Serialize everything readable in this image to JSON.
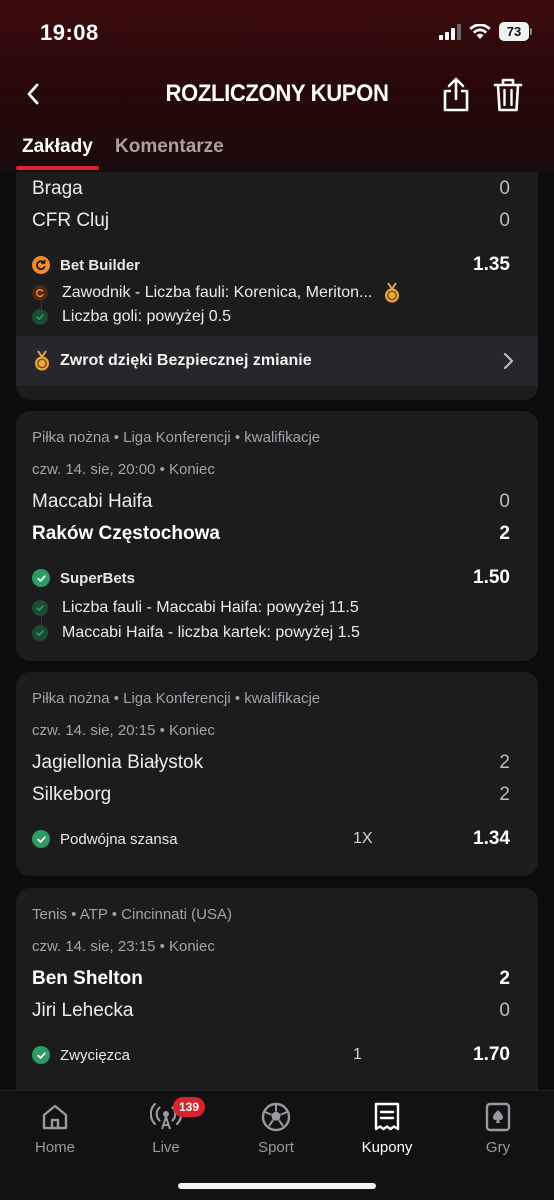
{
  "status": {
    "time": "19:08",
    "battery": "73"
  },
  "header": {
    "title": "ROZLICZONY KUPON"
  },
  "tabs": {
    "bets": "Zakłady",
    "comments": "Komentarze"
  },
  "coupons": [
    {
      "teams": [
        {
          "name": "Braga",
          "score": "0"
        },
        {
          "name": "CFR Cluj",
          "score": "0"
        }
      ],
      "bet": {
        "name": "Bet Builder",
        "odds": "1.35"
      },
      "selections": [
        "Zawodnik - Liczba fauli: Korenica, Meriton...",
        "Liczba goli: powyżej 0.5"
      ],
      "refund": "Zwrot dzięki Bezpiecznej zmianie"
    },
    {
      "league": "Piłka nożna • Liga Konferencji • kwalifikacje",
      "date": "czw. 14. sie, 20:00 • Koniec",
      "teams": [
        {
          "name": "Maccabi Haifa",
          "score": "0"
        },
        {
          "name": "Raków Częstochowa",
          "score": "2"
        }
      ],
      "bet": {
        "name": "SuperBets",
        "odds": "1.50"
      },
      "selections": [
        "Liczba fauli - Maccabi Haifa: powyżej 11.5",
        "Maccabi Haifa - liczba kartek: powyżej 1.5"
      ]
    },
    {
      "league": "Piłka nożna • Liga Konferencji • kwalifikacje",
      "date": "czw. 14. sie, 20:15 • Koniec",
      "teams": [
        {
          "name": "Jagiellonia Białystok",
          "score": "2"
        },
        {
          "name": "Silkeborg",
          "score": "2"
        }
      ],
      "bet": {
        "name": "Podwójna szansa",
        "pick": "1X",
        "odds": "1.34"
      }
    },
    {
      "league": "Tenis • ATP • Cincinnati (USA)",
      "date": "czw. 14. sie, 23:15 • Koniec",
      "teams": [
        {
          "name": "Ben Shelton",
          "score": "2"
        },
        {
          "name": "Jiri Lehecka",
          "score": "0"
        }
      ],
      "bet": {
        "name": "Zwycięzca",
        "pick": "1",
        "odds": "1.70"
      }
    }
  ],
  "tabbar": {
    "items": [
      {
        "label": "Home"
      },
      {
        "label": "Live",
        "badge": "139"
      },
      {
        "label": "Sport"
      },
      {
        "label": "Kupony"
      },
      {
        "label": "Gry"
      }
    ]
  },
  "colors": {
    "accent": "#e1232d",
    "success": "#2d9c62",
    "builder": "#f08a2c",
    "card": "#1c1c1f"
  }
}
